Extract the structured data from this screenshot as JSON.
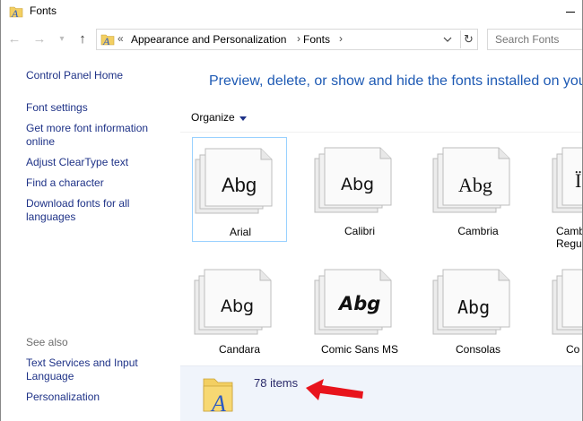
{
  "window": {
    "title": "Fonts"
  },
  "nav": {
    "back_glyph": "←",
    "forward_glyph": "→",
    "recent_glyph": "▾",
    "up_glyph": "↑",
    "address_chevrons": "«",
    "breadcrumbs": [
      "Appearance and Personalization",
      "Fonts"
    ],
    "separator": "›",
    "refresh_glyph": "↻",
    "search_placeholder": "Search Fonts"
  },
  "left_pane": {
    "links": [
      "Control Panel Home",
      "Font settings",
      "Get more font information online",
      "Adjust ClearType text",
      "Find a character",
      "Download fonts for all languages"
    ],
    "see_also_label": "See also",
    "see_also_links": [
      "Text Services and Input Language",
      "Personalization"
    ]
  },
  "main": {
    "heading": "Preview, delete, or show and hide the fonts installed on your",
    "organize_label": "Organize",
    "fonts": [
      {
        "name": "Arial",
        "sample": "Abg",
        "selected": true
      },
      {
        "name": "Calibri",
        "sample": "Abg",
        "selected": false
      },
      {
        "name": "Cambria",
        "sample": "Abg",
        "selected": false
      },
      {
        "name": "Camb\nRegul",
        "sample": "Ï",
        "selected": false
      },
      {
        "name": "Candara",
        "sample": "Abg",
        "selected": false
      },
      {
        "name": "Comic Sans MS",
        "sample": "Abg",
        "selected": false
      },
      {
        "name": "Consolas",
        "sample": "Abg",
        "selected": false
      },
      {
        "name": "Co",
        "sample": "",
        "selected": false
      }
    ]
  },
  "details": {
    "item_count": "78 items"
  },
  "colors": {
    "link": "#1e3287",
    "heading": "#1e5ab4",
    "selection_border": "#99d1ff",
    "details_bg": "#f0f4fb",
    "annotation_arrow": "#e8141c"
  }
}
